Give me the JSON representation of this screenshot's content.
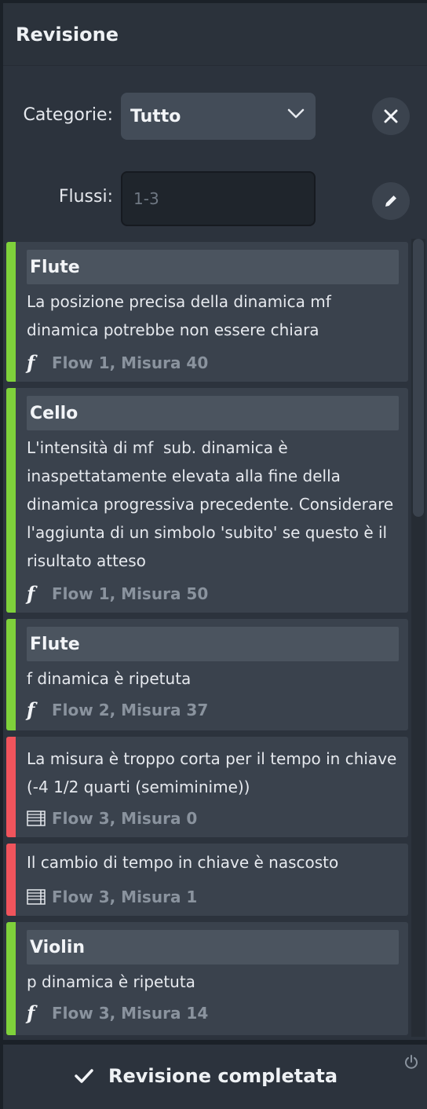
{
  "header": {
    "title": "Revisione"
  },
  "filters": {
    "category_label": "Categorie:",
    "category_value": "Tutto",
    "flows_label": "Flussi:",
    "flows_placeholder": "1-3"
  },
  "issues": [
    {
      "severity": "warning",
      "title": "Flute",
      "message": "La posizione precisa della dinamica mf dinamica potrebbe non essere chiara",
      "icon": "dynamic-f-icon",
      "location": "Flow 1, Misura 40"
    },
    {
      "severity": "warning",
      "title": "Cello",
      "message": "L'intensità di mf  sub. dinamica è inaspettatamente elevata alla fine della dinamica progressiva precedente. Considerare l'aggiunta di un simbolo 'subito' se questo è il risultato atteso",
      "icon": "dynamic-f-icon",
      "location": "Flow 1, Misura 50"
    },
    {
      "severity": "warning",
      "title": "Flute",
      "message": "f dinamica è ripetuta",
      "icon": "dynamic-f-icon",
      "location": "Flow 2, Misura 37"
    },
    {
      "severity": "error",
      "title": "",
      "message": "La misura è troppo corta per il tempo in chiave (-4 1/2 quarti (semiminime))",
      "icon": "measure-icon",
      "location": "Flow 3, Misura 0"
    },
    {
      "severity": "error",
      "title": "",
      "message": "Il cambio di tempo in chiave è nascosto",
      "icon": "measure-icon",
      "location": "Flow 3, Misura 1"
    },
    {
      "severity": "warning",
      "title": "Violin",
      "message": "p dinamica è ripetuta",
      "icon": "dynamic-f-icon",
      "location": "Flow 3, Misura 14"
    }
  ],
  "footer": {
    "complete_label": "Revisione completata"
  },
  "colors": {
    "warning": "#7fd13b",
    "error": "#f0545c"
  }
}
